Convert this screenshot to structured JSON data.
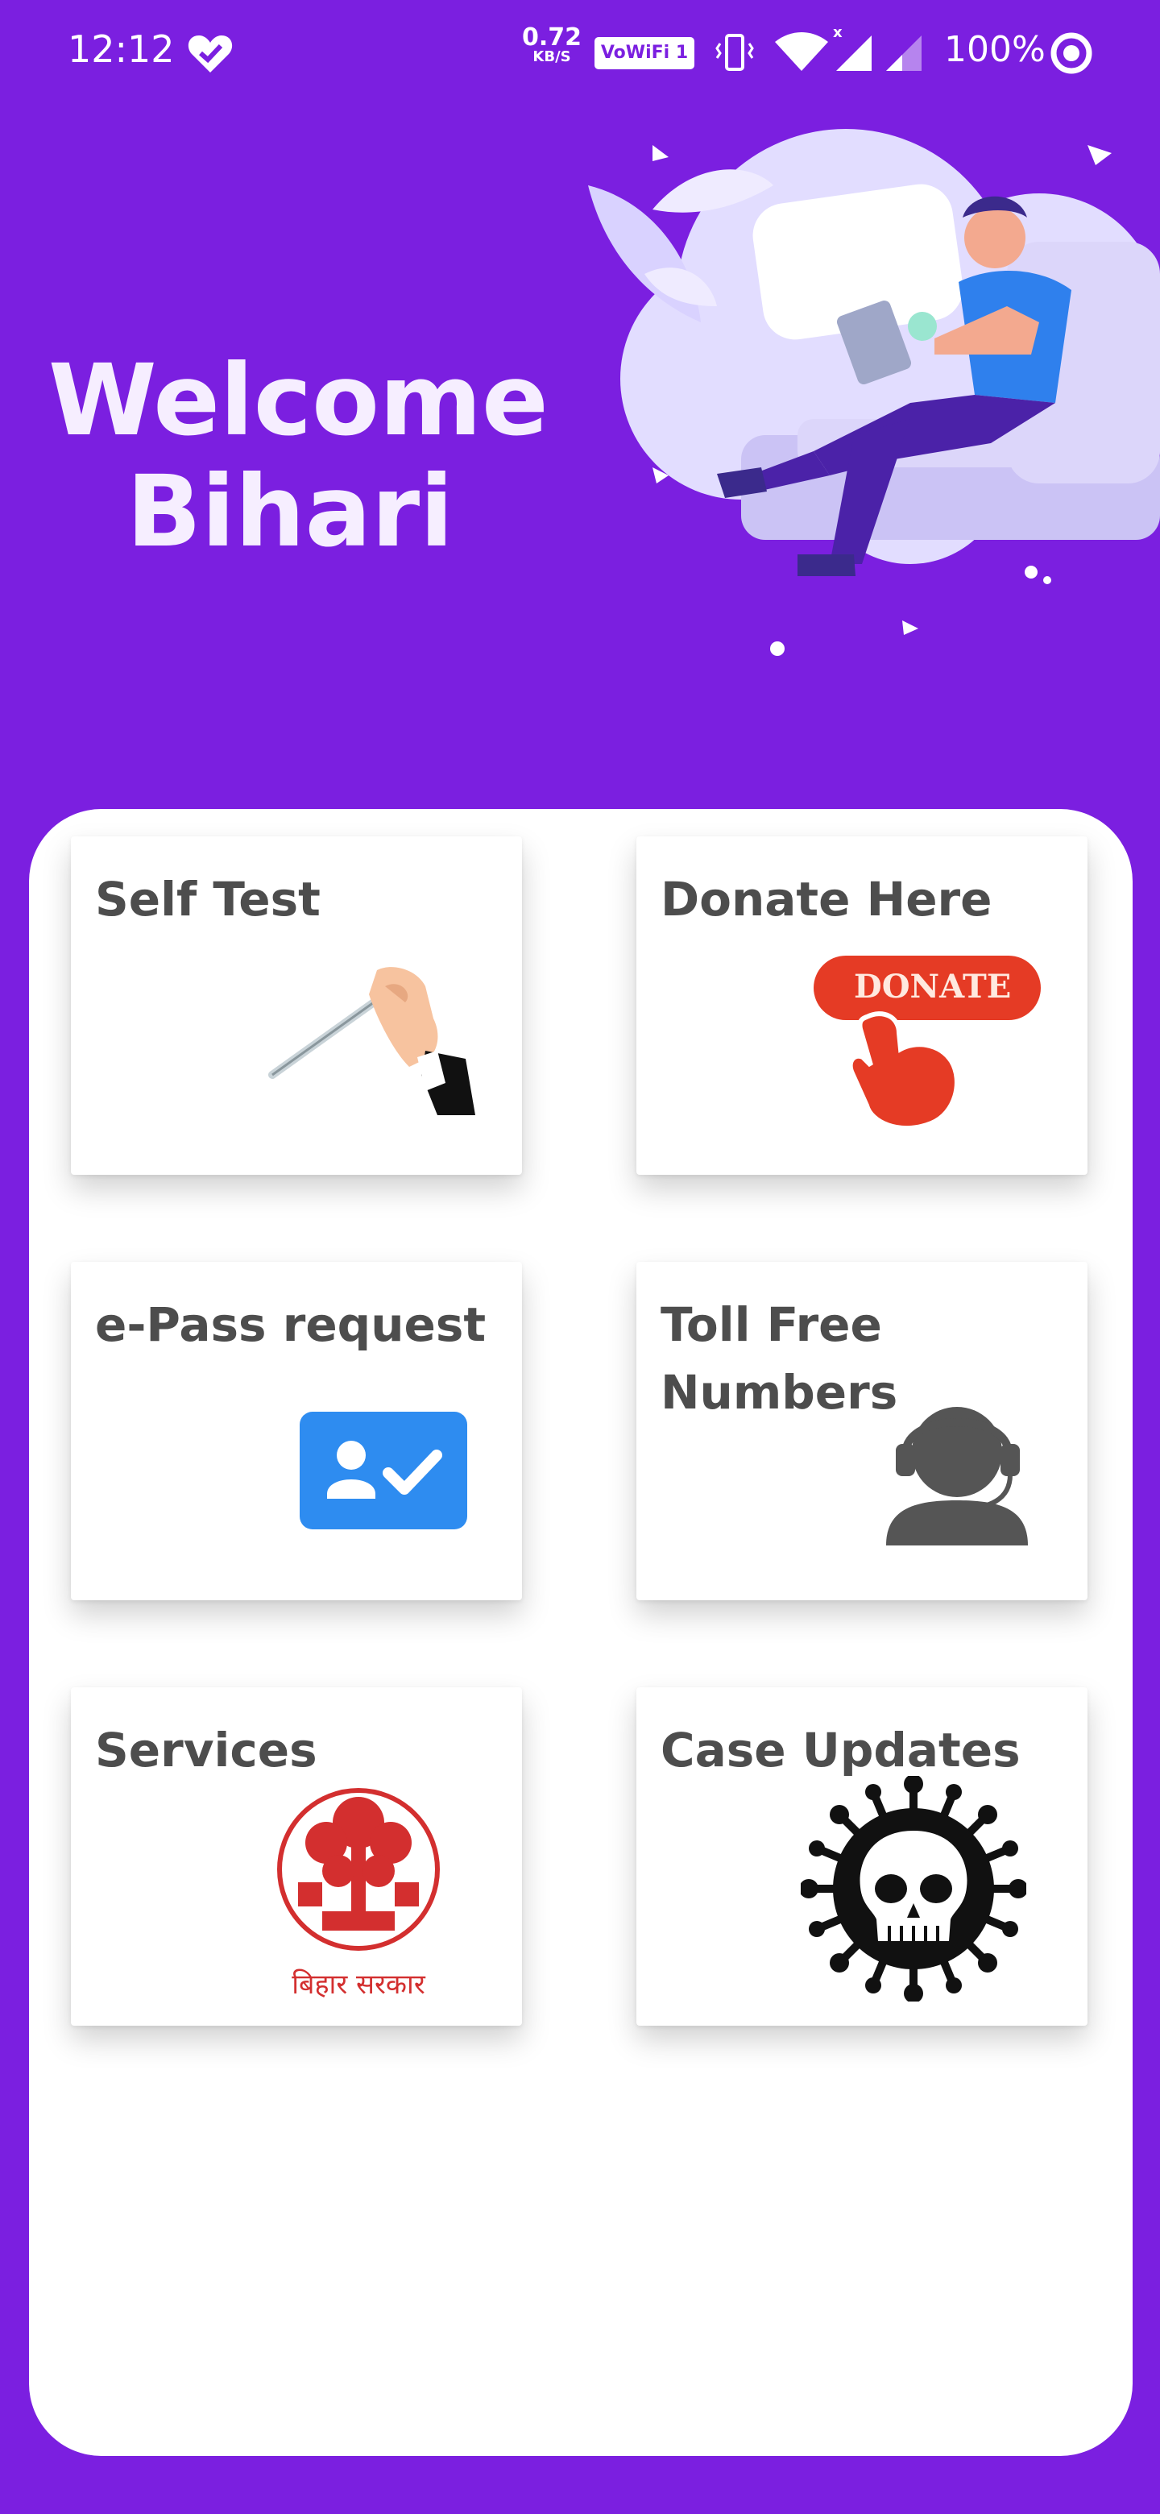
{
  "status_bar": {
    "time": "12:12",
    "net_speed_value": "0.72",
    "net_speed_unit": "KB/S",
    "vowifi_label": "VoWiFi 1",
    "battery_text": "100%"
  },
  "header": {
    "welcome_line1": "Welcome",
    "welcome_line2": "Bihari"
  },
  "tiles": [
    {
      "title": "Self Test",
      "icon": "thermometer-icon"
    },
    {
      "title": "Donate Here",
      "icon": "donate-icon"
    },
    {
      "title": "e-Pass request",
      "icon": "epass-user-check-icon"
    },
    {
      "title": "Toll Free Numbers",
      "icon": "headset-support-icon"
    },
    {
      "title": "Services",
      "icon": "bihar-sarkar-emblem-icon",
      "emblem_text": "बिहार सरकार"
    },
    {
      "title": "Case Updates",
      "icon": "virus-skull-icon"
    }
  ],
  "donate_badge_text": "DONATE",
  "colors": {
    "background": "#7B1FE0",
    "card": "#ffffff",
    "title_text": "#4d4d4d",
    "donate_red": "#E53B25",
    "epass_blue": "#2E8CF0"
  }
}
